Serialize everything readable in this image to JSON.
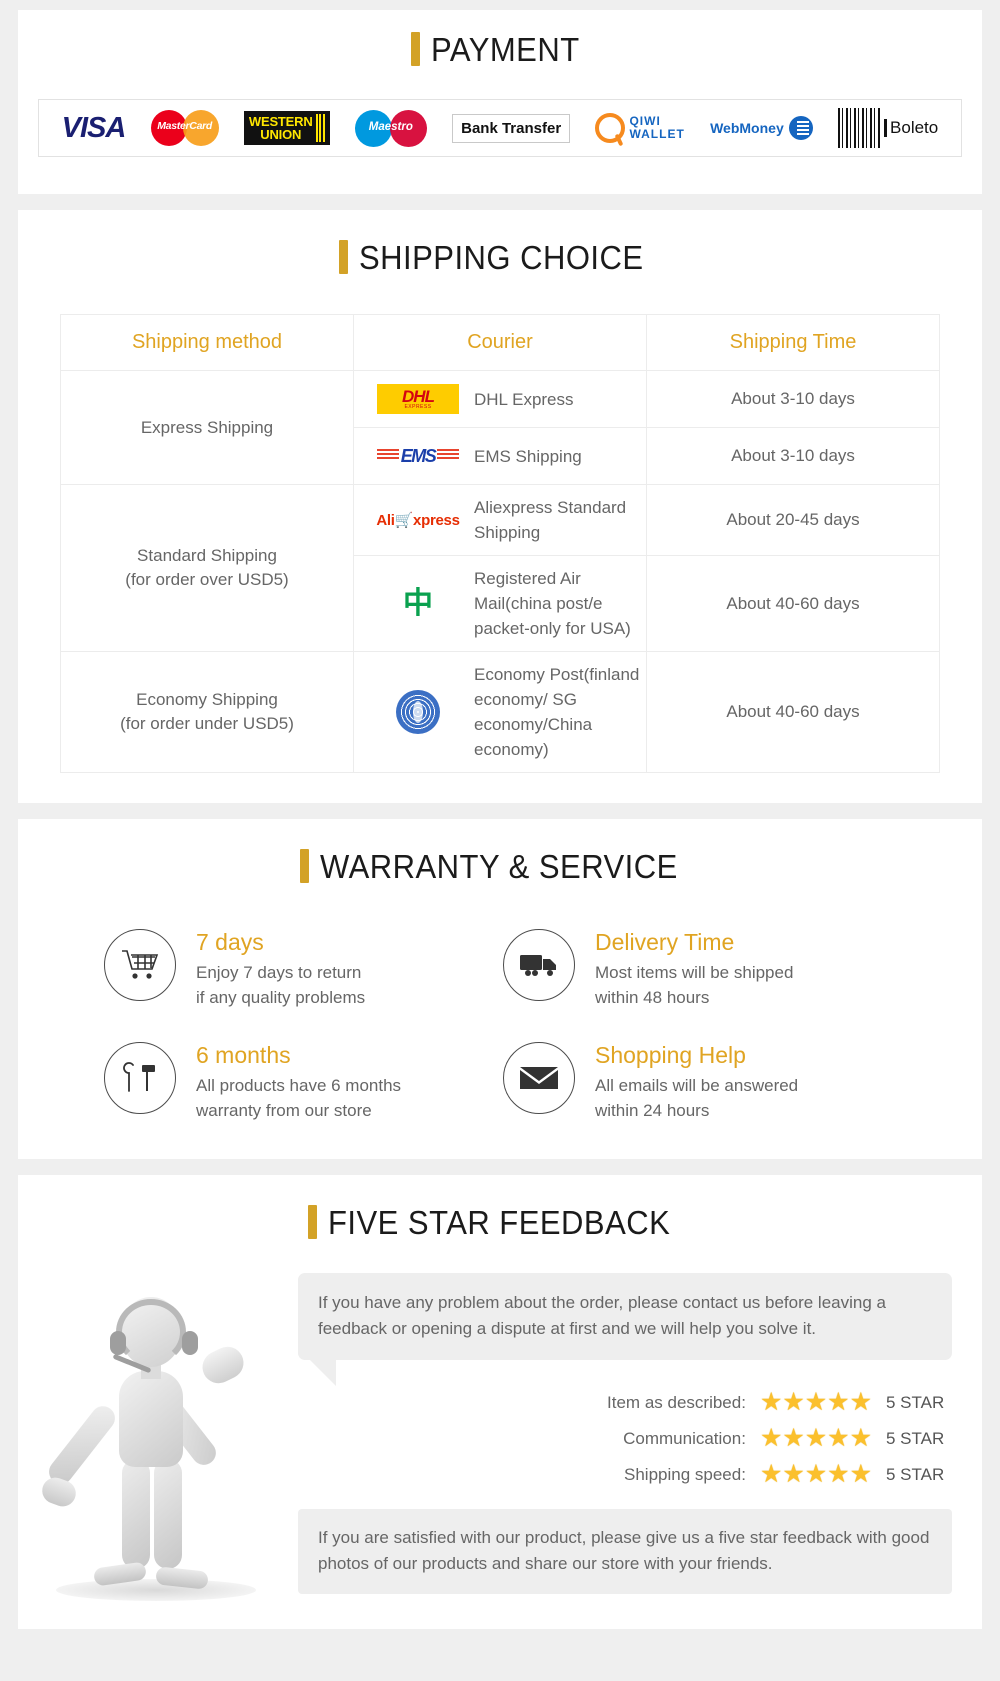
{
  "payment": {
    "title": "PAYMENT",
    "methods": [
      {
        "name": "visa",
        "label": "VISA"
      },
      {
        "name": "mastercard",
        "label": "MasterCard"
      },
      {
        "name": "western-union",
        "label_line1": "WESTERN",
        "label_line2": "UNION"
      },
      {
        "name": "maestro",
        "label": "Maestro"
      },
      {
        "name": "bank-transfer",
        "label": "Bank Transfer"
      },
      {
        "name": "qiwi-wallet",
        "label_line1": "QIWI",
        "label_line2": "WALLET"
      },
      {
        "name": "webmoney",
        "label": "WebMoney"
      },
      {
        "name": "boleto",
        "label": "Boleto"
      }
    ]
  },
  "shipping": {
    "title": "SHIPPING CHOICE",
    "columns": [
      "Shipping method",
      "Courier",
      "Shipping Time"
    ],
    "rows": [
      {
        "method": "Express Shipping",
        "method_sub": "",
        "items": [
          {
            "logo": "dhl-logo",
            "courier": "DHL Express",
            "time": "About 3-10 days"
          },
          {
            "logo": "ems-logo",
            "courier": "EMS Shipping",
            "time": "About 3-10 days"
          }
        ]
      },
      {
        "method": "Standard Shipping",
        "method_sub": "(for order over USD5)",
        "items": [
          {
            "logo": "aliexpress-logo",
            "courier": "Aliexpress Standard Shipping",
            "time": "About 20-45 days"
          },
          {
            "logo": "china-post-logo",
            "courier": "Registered Air Mail(china post/e packet-only for USA)",
            "time": "About 40-60 days"
          }
        ]
      },
      {
        "method": "Economy Shipping",
        "method_sub": "(for order under USD5)",
        "items": [
          {
            "logo": "economy-post-logo",
            "courier": "Economy Post(finland economy/ SG economy/China economy)",
            "time": "About 40-60 days"
          }
        ]
      }
    ]
  },
  "warranty": {
    "title": "WARRANTY & SERVICE",
    "items": [
      {
        "icon": "shopping-cart-icon",
        "heading": "7 days",
        "line1": "Enjoy 7 days to return",
        "line2": "if any quality problems"
      },
      {
        "icon": "delivery-truck-icon",
        "heading": "Delivery Time",
        "line1": "Most items will be shipped",
        "line2": "within 48 hours"
      },
      {
        "icon": "tools-icon",
        "heading": "6 months",
        "line1": "All products have 6 months",
        "line2": "warranty from our store"
      },
      {
        "icon": "envelope-icon",
        "heading": "Shopping Help",
        "line1": "All emails will be answered",
        "line2": "within 24 hours"
      }
    ]
  },
  "feedback": {
    "title": "FIVE STAR FEEDBACK",
    "bubble": "If you have any problem about the order, please contact us before leaving a feedback or opening a dispute at first and we will help you solve it.",
    "ratings": [
      {
        "label": "Item as described:",
        "stars": 5,
        "value": "5 STAR"
      },
      {
        "label": "Communication:",
        "stars": 5,
        "value": "5 STAR"
      },
      {
        "label": "Shipping speed:",
        "stars": 5,
        "value": "5 STAR"
      }
    ],
    "note": "If you are satisfied with our product, please give us a five star feedback with good photos of our products and share our store with your friends."
  },
  "colors": {
    "accent": "#d3a227",
    "heading_gold": "#e0a422",
    "body_text": "#666666",
    "star": "#fbc02d",
    "page_bg": "#efefef"
  }
}
